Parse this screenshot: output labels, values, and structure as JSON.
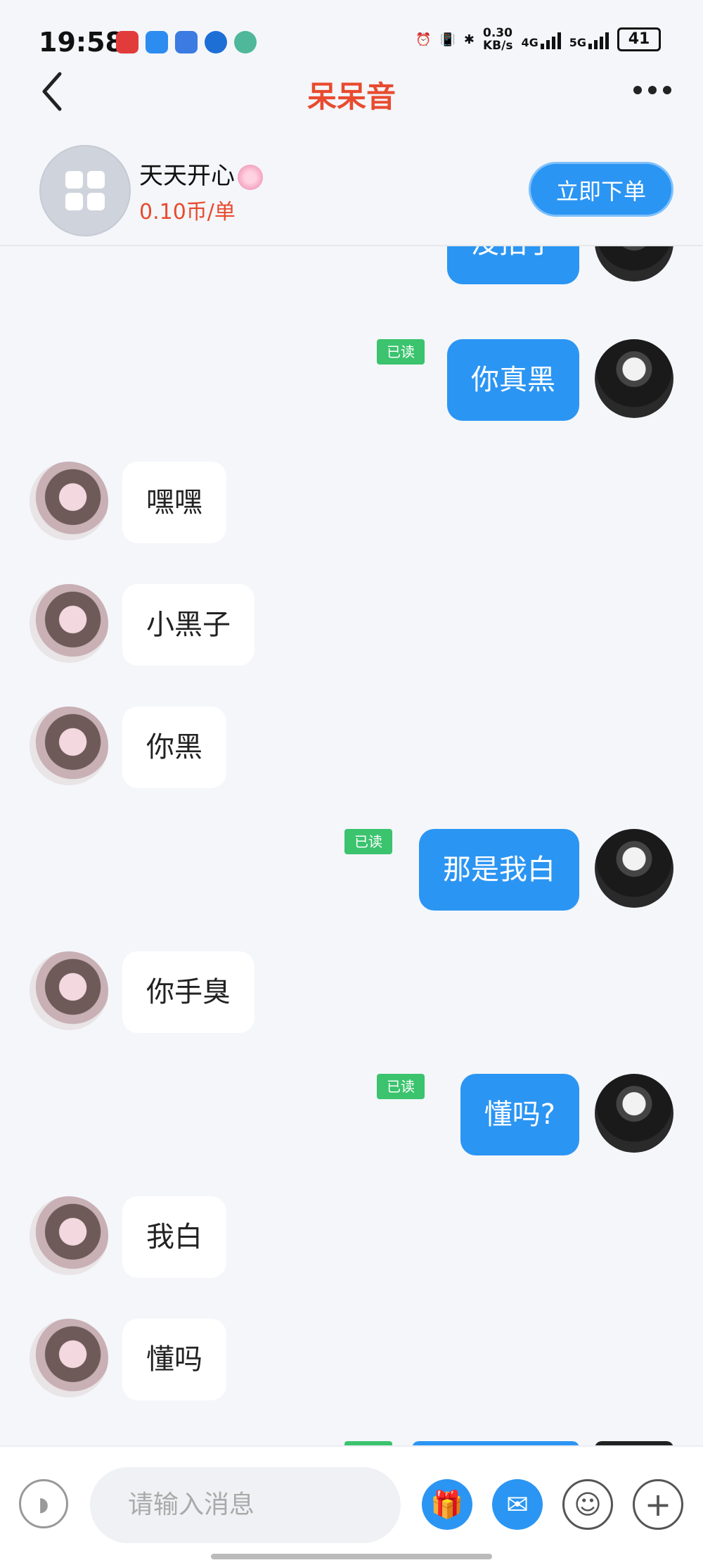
{
  "status_bar": {
    "time": "19:58",
    "network_speed": "0.30",
    "network_speed_unit": "KB/s",
    "net_4g": "4G",
    "net_5g": "5G",
    "battery": "41"
  },
  "nav": {
    "title": "呆呆音"
  },
  "store": {
    "name": "天天开心",
    "price": "0.10币/单",
    "order_button": "立即下单"
  },
  "messages": [
    {
      "sender": "me",
      "text": "没招了",
      "read": false
    },
    {
      "sender": "me",
      "text": "你真黑",
      "read": true,
      "read_label": "已读"
    },
    {
      "sender": "her",
      "text": "嘿嘿"
    },
    {
      "sender": "her",
      "text": "小黑子"
    },
    {
      "sender": "her",
      "text": "你黑"
    },
    {
      "sender": "me",
      "text": "那是我白",
      "read": true,
      "read_label": "已读"
    },
    {
      "sender": "her",
      "text": "你手臭"
    },
    {
      "sender": "me",
      "text": "懂吗?",
      "read": true,
      "read_label": "已读"
    },
    {
      "sender": "her",
      "text": "我白"
    },
    {
      "sender": "her",
      "text": "懂吗"
    }
  ],
  "input_bar": {
    "placeholder": "请输入消息"
  },
  "colors": {
    "accent": "#2b95f3",
    "title_red": "#e84b2f",
    "read_green": "#3bc36e",
    "background": "#f4f6fa"
  }
}
